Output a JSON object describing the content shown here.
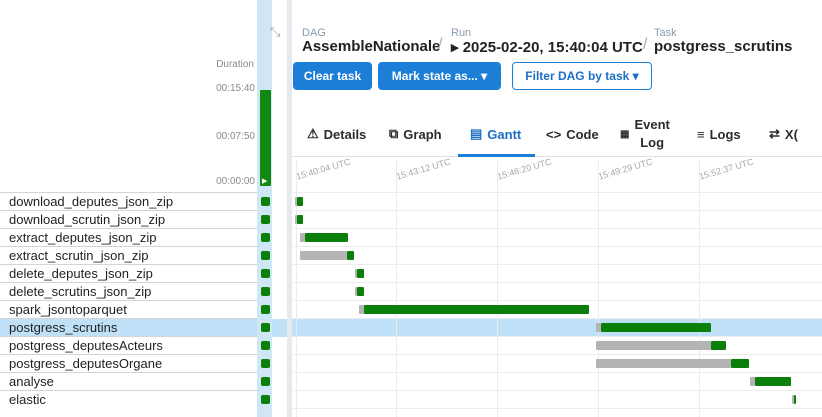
{
  "breadcrumb": {
    "dag_label": "DAG",
    "dag_value": "AssembleNationale",
    "run_label": "Run",
    "run_value": "▸ 2025-02-20, 15:40:04 UTC",
    "task_label": "Task",
    "task_value": "postgress_scrutins"
  },
  "toolbar": {
    "clear_task": "Clear task",
    "mark_state": "Mark state as... ▾",
    "filter_dag": "Filter DAG by task ▾"
  },
  "tabs": [
    {
      "label": "Details",
      "icon": "⚠"
    },
    {
      "label": "Graph",
      "icon": "⧉"
    },
    {
      "label": "Gantt",
      "icon": "▤"
    },
    {
      "label": "Code",
      "icon": "<>"
    },
    {
      "label": "Event\nLog",
      "icon": "▦"
    },
    {
      "label": "Logs",
      "icon": "≡"
    },
    {
      "label": "X(",
      "icon": "⇄"
    }
  ],
  "grid": {
    "duration_label": "Duration",
    "ticks": [
      "00:15:40",
      "00:07:50",
      "00:00:00"
    ],
    "collapse_icon": "⤡"
  },
  "tasks": [
    "download_deputes_json_zip",
    "download_scrutin_json_zip",
    "extract_deputes_json_zip",
    "extract_scrutin_json_zip",
    "delete_deputes_json_zip",
    "delete_scrutins_json_zip",
    "spark_jsontoparquet",
    "postgress_scrutins",
    "postgress_deputesActeurs",
    "postgress_deputesOrgane",
    "analyse",
    "elastic"
  ],
  "selected_task": "postgress_scrutins",
  "gantt": {
    "time_labels": [
      "15:40:04 UTC",
      "15:43:12 UTC",
      "15:46:20 UTC",
      "15:49:29 UTC",
      "15:52:37 UTC"
    ],
    "colors": {
      "queued": "#b4b4b4",
      "success": "#0a800a",
      "selected_row": "#bfe0f6"
    }
  }
}
